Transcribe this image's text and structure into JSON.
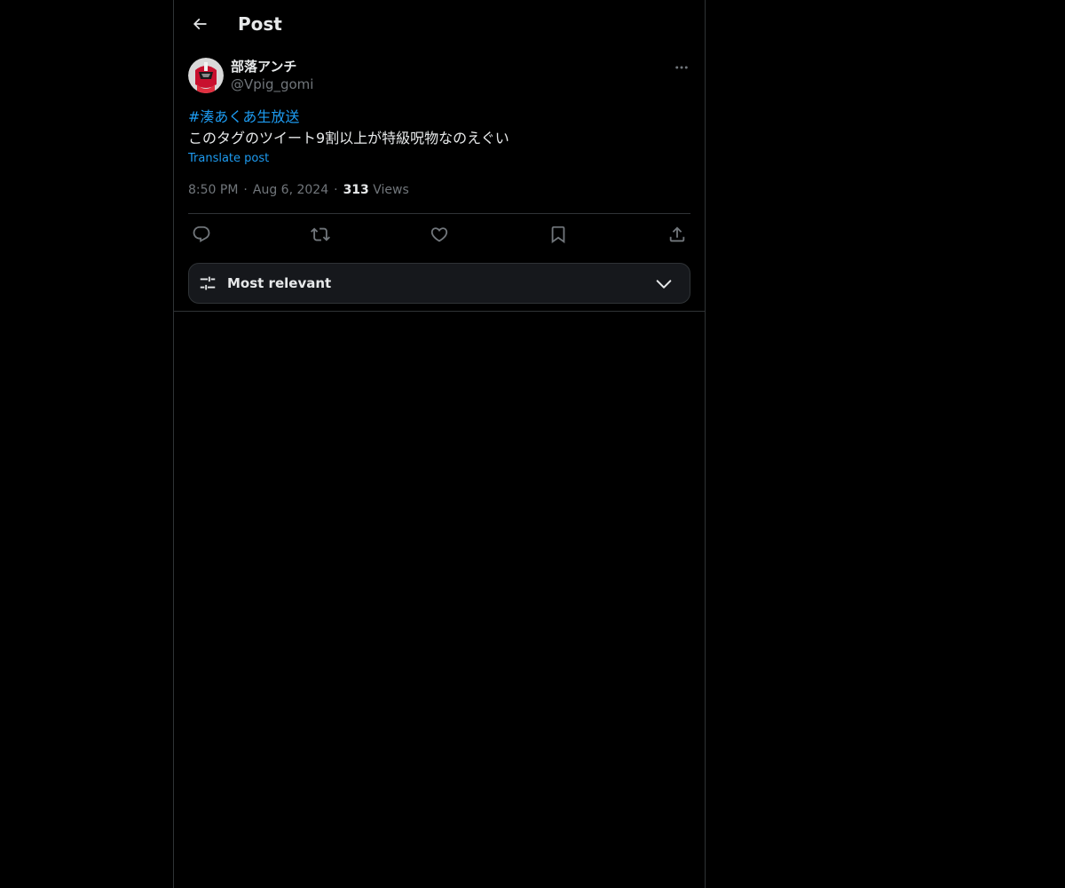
{
  "header": {
    "title": "Post",
    "back_icon": "arrow-left-icon"
  },
  "post": {
    "author": {
      "display_name": "部落アンチ",
      "handle": "@Vpig_gomi"
    },
    "hashtag": "#湊あくあ生放送",
    "text": "このタグのツイート9割以上が特級呪物なのえぐい",
    "translate_label": "Translate post",
    "time": "8:50 PM",
    "date": "Aug 6, 2024",
    "views_count": "313",
    "views_label": "Views",
    "actions": [
      "reply-icon",
      "repost-icon",
      "like-icon",
      "bookmark-icon",
      "share-icon"
    ]
  },
  "sort": {
    "label": "Most relevant"
  },
  "colors": {
    "background": "#000000",
    "text": "#e7e9ea",
    "muted": "#71767b",
    "accent": "#1d9bf0",
    "border": "#2f3336"
  }
}
